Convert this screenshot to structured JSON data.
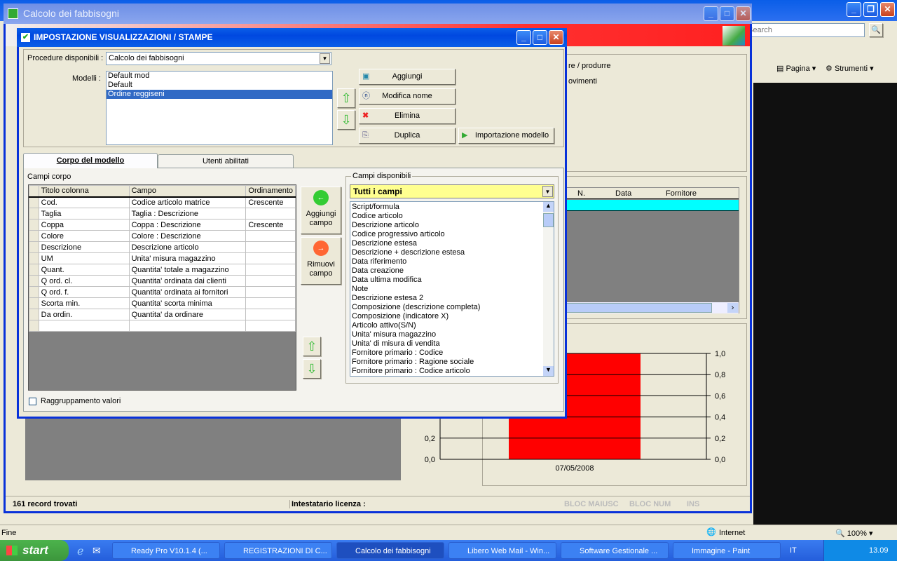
{
  "browser": {
    "search_placeholder": "Search",
    "page_menu": "Pagina",
    "tools_menu": "Strumenti",
    "status": "Fine",
    "zone": "Internet",
    "zoom": "100%"
  },
  "app": {
    "title": "Calcolo dei fabbisogni",
    "fragments": [
      "re / produrre",
      "ovimenti"
    ],
    "grid_headers": [
      "N.",
      "Data",
      "Fornitore"
    ],
    "status": {
      "records": "161 record trovati",
      "license": "Intestatario licenza :",
      "caps": "BLOC MAIUSC",
      "num": "BLOC NUM",
      "ins": "INS"
    }
  },
  "chart_data": {
    "type": "bar",
    "categories": [
      "07/05/2008"
    ],
    "values": [
      1.0
    ],
    "ylim": [
      0,
      1
    ],
    "yticks": [
      "0,0",
      "0,2",
      "0,4",
      "0,6",
      "0,8",
      "1,0"
    ],
    "title": "",
    "xlabel": "",
    "ylabel": "",
    "color": "#ff0000"
  },
  "dialog": {
    "title": "IMPOSTAZIONE VISUALIZZAZIONI / STAMPE",
    "procedures_label": "Procedure disponibili :",
    "procedure_value": "Calcolo dei fabbisogni",
    "models_label": "Modelli :",
    "models": [
      "Default mod",
      "Default",
      "Ordine reggiseni"
    ],
    "selected_model": 2,
    "buttons": {
      "add": "Aggiungi",
      "rename": "Modifica nome",
      "delete": "Elimina",
      "duplicate": "Duplica",
      "import": "Importazione modello"
    },
    "tabs": [
      "Corpo del modello",
      "Utenti abilitati"
    ],
    "body_fields_label": "Campi corpo",
    "columns": [
      "Titolo colonna",
      "Campo",
      "Ordinamento"
    ],
    "rows": [
      [
        "Cod.",
        "Codice articolo matrice",
        "Crescente"
      ],
      [
        "Taglia",
        "Taglia : Descrizione",
        ""
      ],
      [
        "Coppa",
        "Coppa : Descrizione",
        "Crescente"
      ],
      [
        "Colore",
        "Colore : Descrizione",
        ""
      ],
      [
        "Descrizione",
        "Descrizione articolo",
        ""
      ],
      [
        "UM",
        "Unita' misura magazzino",
        ""
      ],
      [
        "Quant.",
        "Quantita' totale a magazzino",
        ""
      ],
      [
        "Q ord. cl.",
        "Quantita' ordinata dai clienti",
        ""
      ],
      [
        "Q ord. f.",
        "Quantita' ordinata ai fornitori",
        ""
      ],
      [
        "Scorta min.",
        "Quantita' scorta minima",
        ""
      ],
      [
        "Da ordin.",
        "Quantita' da ordinare",
        ""
      ],
      [
        "",
        "",
        ""
      ]
    ],
    "add_field": "Aggiungi campo",
    "remove_field": "Rimuovi campo",
    "available_label": "Campi disponibili",
    "filter_value": "Tutti i campi",
    "available": [
      "Script/formula",
      "Codice articolo",
      "Descrizione articolo",
      "Codice progressivo articolo",
      "Descrizione estesa",
      "Descrizione + descrizione estesa",
      "Data riferimento",
      "Data creazione",
      "Data ultima modifica",
      "Note",
      "Descrizione estesa 2",
      "Composizione (descrizione completa)",
      "Composizione (indicatore X)",
      "Articolo attivo(S/N)",
      "Unita' misura magazzino",
      "Unita' di misura di vendita",
      "Fornitore primario : Codice",
      "Fornitore primario : Ragione sociale",
      "Fornitore primario : Codice articolo"
    ],
    "group_values": "Raggruppamento valori"
  },
  "taskbar": {
    "start": "start",
    "items": [
      "Ready Pro V10.1.4 (...",
      "REGISTRAZIONI DI C...",
      "Calcolo dei fabbisogni",
      "Libero Web Mail - Win...",
      "Software Gestionale ...",
      "Immagine - Paint"
    ],
    "lang": "IT",
    "clock": "13.09"
  }
}
